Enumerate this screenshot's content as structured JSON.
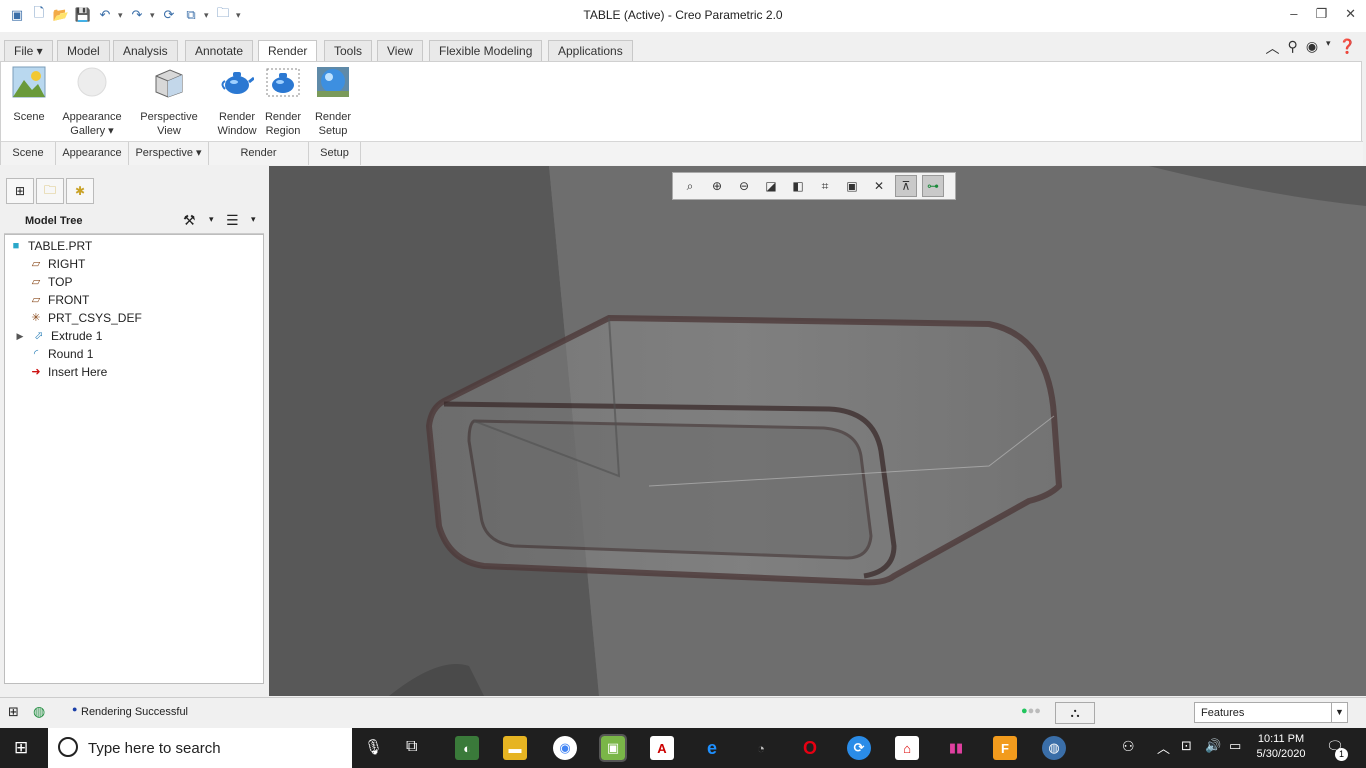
{
  "window": {
    "title": "TABLE (Active) - Creo Parametric 2.0"
  },
  "menu": {
    "tabs": [
      "File",
      "Model",
      "Analysis",
      "Annotate",
      "Render",
      "Tools",
      "View",
      "Flexible Modeling",
      "Applications"
    ],
    "active_tab": "Render"
  },
  "ribbon": {
    "scene": "Scene",
    "appearance_gallery_l1": "Appearance",
    "appearance_gallery_l2": "Gallery",
    "perspective_l1": "Perspective",
    "perspective_l2": "View",
    "render_window_l1": "Render",
    "render_window_l2": "Window",
    "render_region_l1": "Render",
    "render_region_l2": "Region",
    "render_setup_l1": "Render",
    "render_setup_l2": "Setup",
    "group_labels": [
      "Scene",
      "Appearance",
      "Perspective",
      "Render",
      "Setup"
    ]
  },
  "model_tree": {
    "header": "Model Tree",
    "root": "TABLE.PRT",
    "items": [
      "RIGHT",
      "TOP",
      "FRONT",
      "PRT_CSYS_DEF",
      "Extrude 1",
      "Round 1",
      "Insert Here"
    ]
  },
  "status": {
    "message": "Rendering Successful",
    "filter": "Features"
  },
  "taskbar": {
    "search_placeholder": "Type here to search",
    "time": "10:11 PM",
    "date": "5/30/2020",
    "notifications": "1"
  },
  "colors": {
    "accent": "#3a6ea8",
    "status_green": "#22c55e",
    "taskbar_bg": "#1f1f1f",
    "viewport_bg": "#6b6b6b",
    "insert_arrow": "#cc1111"
  }
}
